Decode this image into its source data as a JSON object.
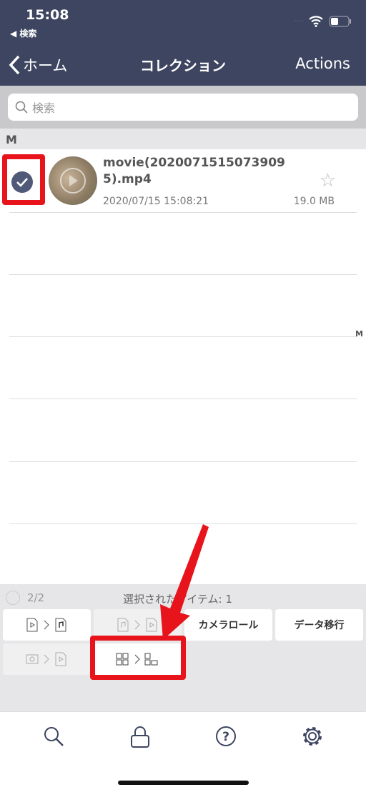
{
  "status": {
    "time": "15:08",
    "back_app": "◀ 検索"
  },
  "nav": {
    "back_label": "ホーム",
    "title": "コレクション",
    "actions_label": "Actions"
  },
  "search": {
    "placeholder": "検索"
  },
  "section": "M",
  "index_letter": "M",
  "items": [
    {
      "name": "movie(20200715150739095).mp4",
      "date": "2020/07/15 15:08:21",
      "size": "19.0 MB",
      "selected": true,
      "favorite": false
    }
  ],
  "panel": {
    "count": "2/2",
    "selected_text": "選択されたアイテム: 1",
    "buttons": [
      {
        "icon": "video-to-audio-icon",
        "enabled": true
      },
      {
        "icon": "audio-to-video-icon",
        "enabled": false
      },
      {
        "label": "カメラロール",
        "enabled": true
      },
      {
        "label": "データ移行",
        "enabled": true
      },
      {
        "icon": "photo-to-video-icon",
        "enabled": false
      },
      {
        "icon": "grid-to-grid-icon",
        "enabled": true,
        "highlighted": true
      }
    ]
  },
  "tabs": [
    {
      "icon": "search-icon"
    },
    {
      "icon": "lock-icon"
    },
    {
      "icon": "help-icon"
    },
    {
      "icon": "gear-icon"
    }
  ],
  "colors": {
    "header": "#3d4560",
    "highlight": "#e8141c",
    "accent": "#505a78"
  }
}
